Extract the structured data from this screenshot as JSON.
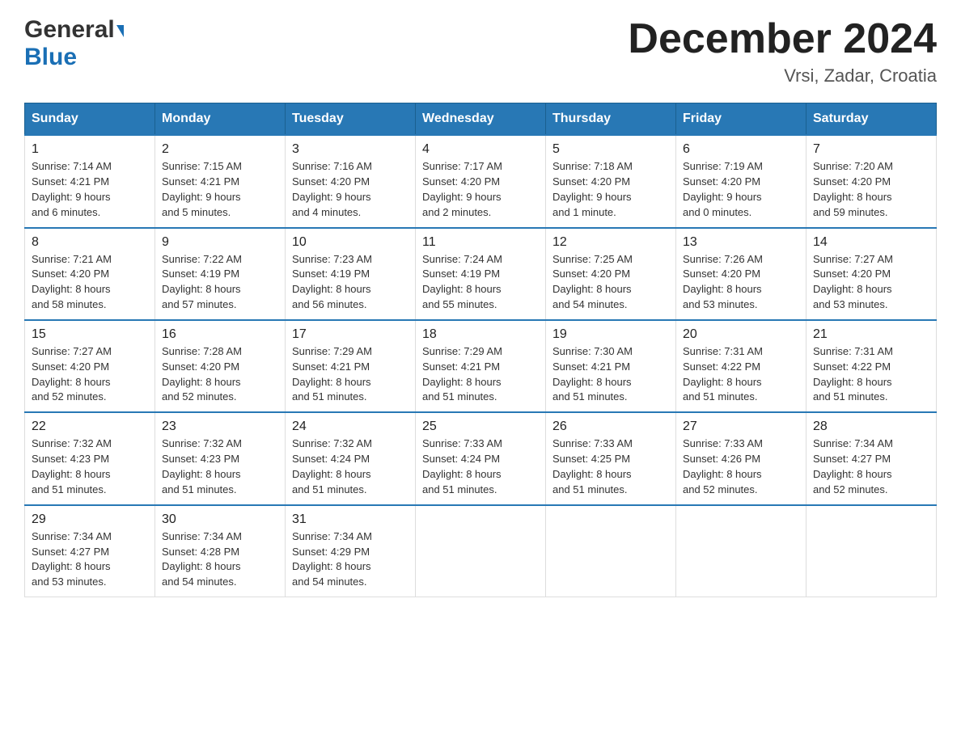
{
  "header": {
    "logo_line1": "General",
    "logo_line2": "Blue",
    "month": "December 2024",
    "location": "Vrsi, Zadar, Croatia"
  },
  "days_of_week": [
    "Sunday",
    "Monday",
    "Tuesday",
    "Wednesday",
    "Thursday",
    "Friday",
    "Saturday"
  ],
  "weeks": [
    [
      {
        "day": "1",
        "info": "Sunrise: 7:14 AM\nSunset: 4:21 PM\nDaylight: 9 hours\nand 6 minutes."
      },
      {
        "day": "2",
        "info": "Sunrise: 7:15 AM\nSunset: 4:21 PM\nDaylight: 9 hours\nand 5 minutes."
      },
      {
        "day": "3",
        "info": "Sunrise: 7:16 AM\nSunset: 4:20 PM\nDaylight: 9 hours\nand 4 minutes."
      },
      {
        "day": "4",
        "info": "Sunrise: 7:17 AM\nSunset: 4:20 PM\nDaylight: 9 hours\nand 2 minutes."
      },
      {
        "day": "5",
        "info": "Sunrise: 7:18 AM\nSunset: 4:20 PM\nDaylight: 9 hours\nand 1 minute."
      },
      {
        "day": "6",
        "info": "Sunrise: 7:19 AM\nSunset: 4:20 PM\nDaylight: 9 hours\nand 0 minutes."
      },
      {
        "day": "7",
        "info": "Sunrise: 7:20 AM\nSunset: 4:20 PM\nDaylight: 8 hours\nand 59 minutes."
      }
    ],
    [
      {
        "day": "8",
        "info": "Sunrise: 7:21 AM\nSunset: 4:20 PM\nDaylight: 8 hours\nand 58 minutes."
      },
      {
        "day": "9",
        "info": "Sunrise: 7:22 AM\nSunset: 4:19 PM\nDaylight: 8 hours\nand 57 minutes."
      },
      {
        "day": "10",
        "info": "Sunrise: 7:23 AM\nSunset: 4:19 PM\nDaylight: 8 hours\nand 56 minutes."
      },
      {
        "day": "11",
        "info": "Sunrise: 7:24 AM\nSunset: 4:19 PM\nDaylight: 8 hours\nand 55 minutes."
      },
      {
        "day": "12",
        "info": "Sunrise: 7:25 AM\nSunset: 4:20 PM\nDaylight: 8 hours\nand 54 minutes."
      },
      {
        "day": "13",
        "info": "Sunrise: 7:26 AM\nSunset: 4:20 PM\nDaylight: 8 hours\nand 53 minutes."
      },
      {
        "day": "14",
        "info": "Sunrise: 7:27 AM\nSunset: 4:20 PM\nDaylight: 8 hours\nand 53 minutes."
      }
    ],
    [
      {
        "day": "15",
        "info": "Sunrise: 7:27 AM\nSunset: 4:20 PM\nDaylight: 8 hours\nand 52 minutes."
      },
      {
        "day": "16",
        "info": "Sunrise: 7:28 AM\nSunset: 4:20 PM\nDaylight: 8 hours\nand 52 minutes."
      },
      {
        "day": "17",
        "info": "Sunrise: 7:29 AM\nSunset: 4:21 PM\nDaylight: 8 hours\nand 51 minutes."
      },
      {
        "day": "18",
        "info": "Sunrise: 7:29 AM\nSunset: 4:21 PM\nDaylight: 8 hours\nand 51 minutes."
      },
      {
        "day": "19",
        "info": "Sunrise: 7:30 AM\nSunset: 4:21 PM\nDaylight: 8 hours\nand 51 minutes."
      },
      {
        "day": "20",
        "info": "Sunrise: 7:31 AM\nSunset: 4:22 PM\nDaylight: 8 hours\nand 51 minutes."
      },
      {
        "day": "21",
        "info": "Sunrise: 7:31 AM\nSunset: 4:22 PM\nDaylight: 8 hours\nand 51 minutes."
      }
    ],
    [
      {
        "day": "22",
        "info": "Sunrise: 7:32 AM\nSunset: 4:23 PM\nDaylight: 8 hours\nand 51 minutes."
      },
      {
        "day": "23",
        "info": "Sunrise: 7:32 AM\nSunset: 4:23 PM\nDaylight: 8 hours\nand 51 minutes."
      },
      {
        "day": "24",
        "info": "Sunrise: 7:32 AM\nSunset: 4:24 PM\nDaylight: 8 hours\nand 51 minutes."
      },
      {
        "day": "25",
        "info": "Sunrise: 7:33 AM\nSunset: 4:24 PM\nDaylight: 8 hours\nand 51 minutes."
      },
      {
        "day": "26",
        "info": "Sunrise: 7:33 AM\nSunset: 4:25 PM\nDaylight: 8 hours\nand 51 minutes."
      },
      {
        "day": "27",
        "info": "Sunrise: 7:33 AM\nSunset: 4:26 PM\nDaylight: 8 hours\nand 52 minutes."
      },
      {
        "day": "28",
        "info": "Sunrise: 7:34 AM\nSunset: 4:27 PM\nDaylight: 8 hours\nand 52 minutes."
      }
    ],
    [
      {
        "day": "29",
        "info": "Sunrise: 7:34 AM\nSunset: 4:27 PM\nDaylight: 8 hours\nand 53 minutes."
      },
      {
        "day": "30",
        "info": "Sunrise: 7:34 AM\nSunset: 4:28 PM\nDaylight: 8 hours\nand 54 minutes."
      },
      {
        "day": "31",
        "info": "Sunrise: 7:34 AM\nSunset: 4:29 PM\nDaylight: 8 hours\nand 54 minutes."
      },
      {
        "day": "",
        "info": ""
      },
      {
        "day": "",
        "info": ""
      },
      {
        "day": "",
        "info": ""
      },
      {
        "day": "",
        "info": ""
      }
    ]
  ]
}
